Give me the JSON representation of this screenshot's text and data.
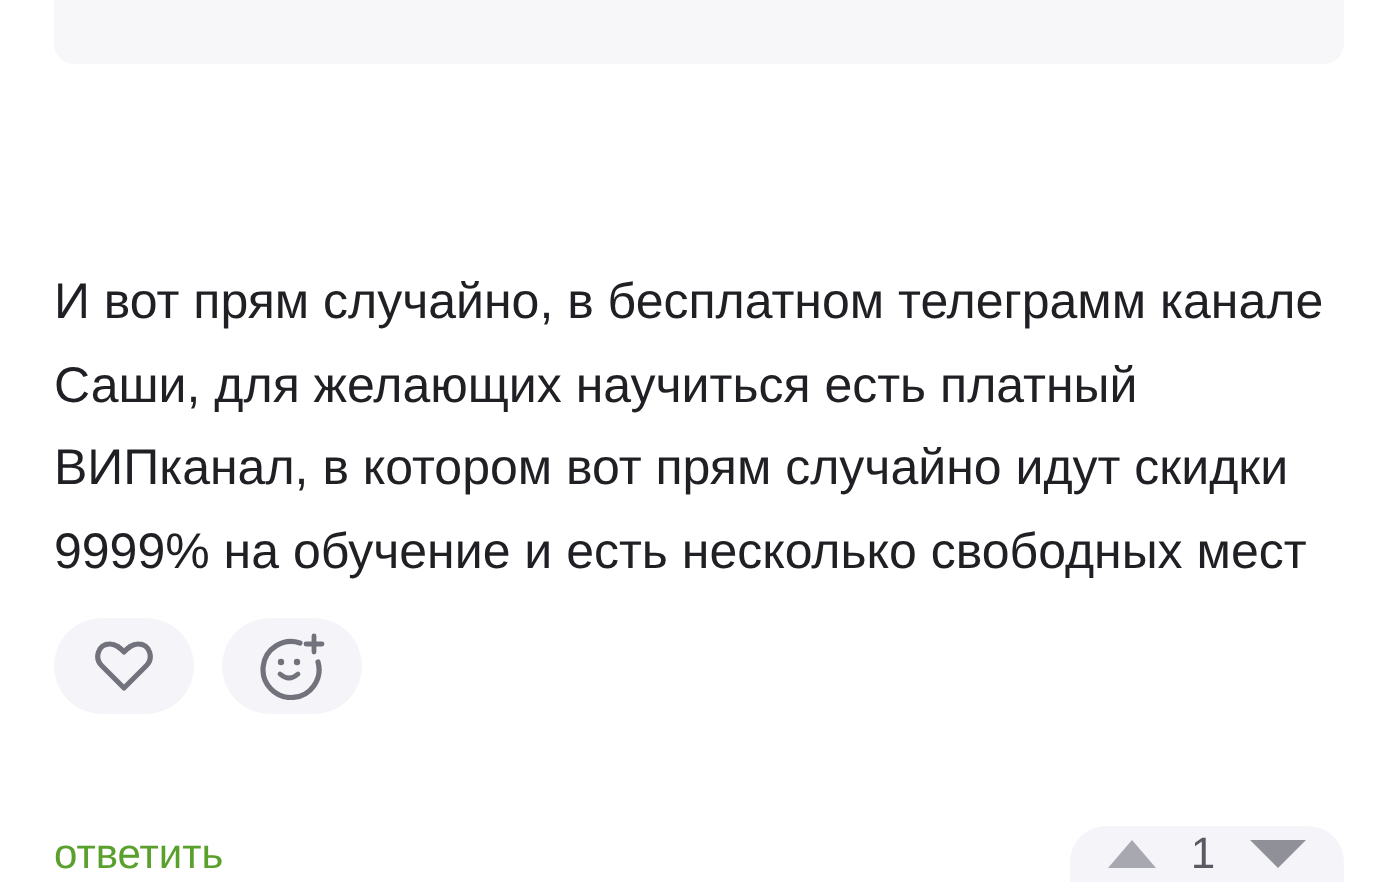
{
  "comment": {
    "text": "И вот прям случайно, в бесплатном телеграмм канале Саши, для желающих научиться есть платный ВИПканал, в котором вот прям случайно идут скидки 9999% на обучение и есть несколько свободных мест"
  },
  "reactions": {
    "liked": false
  },
  "reply_link": "ответить",
  "votes": {
    "score": "1"
  }
}
